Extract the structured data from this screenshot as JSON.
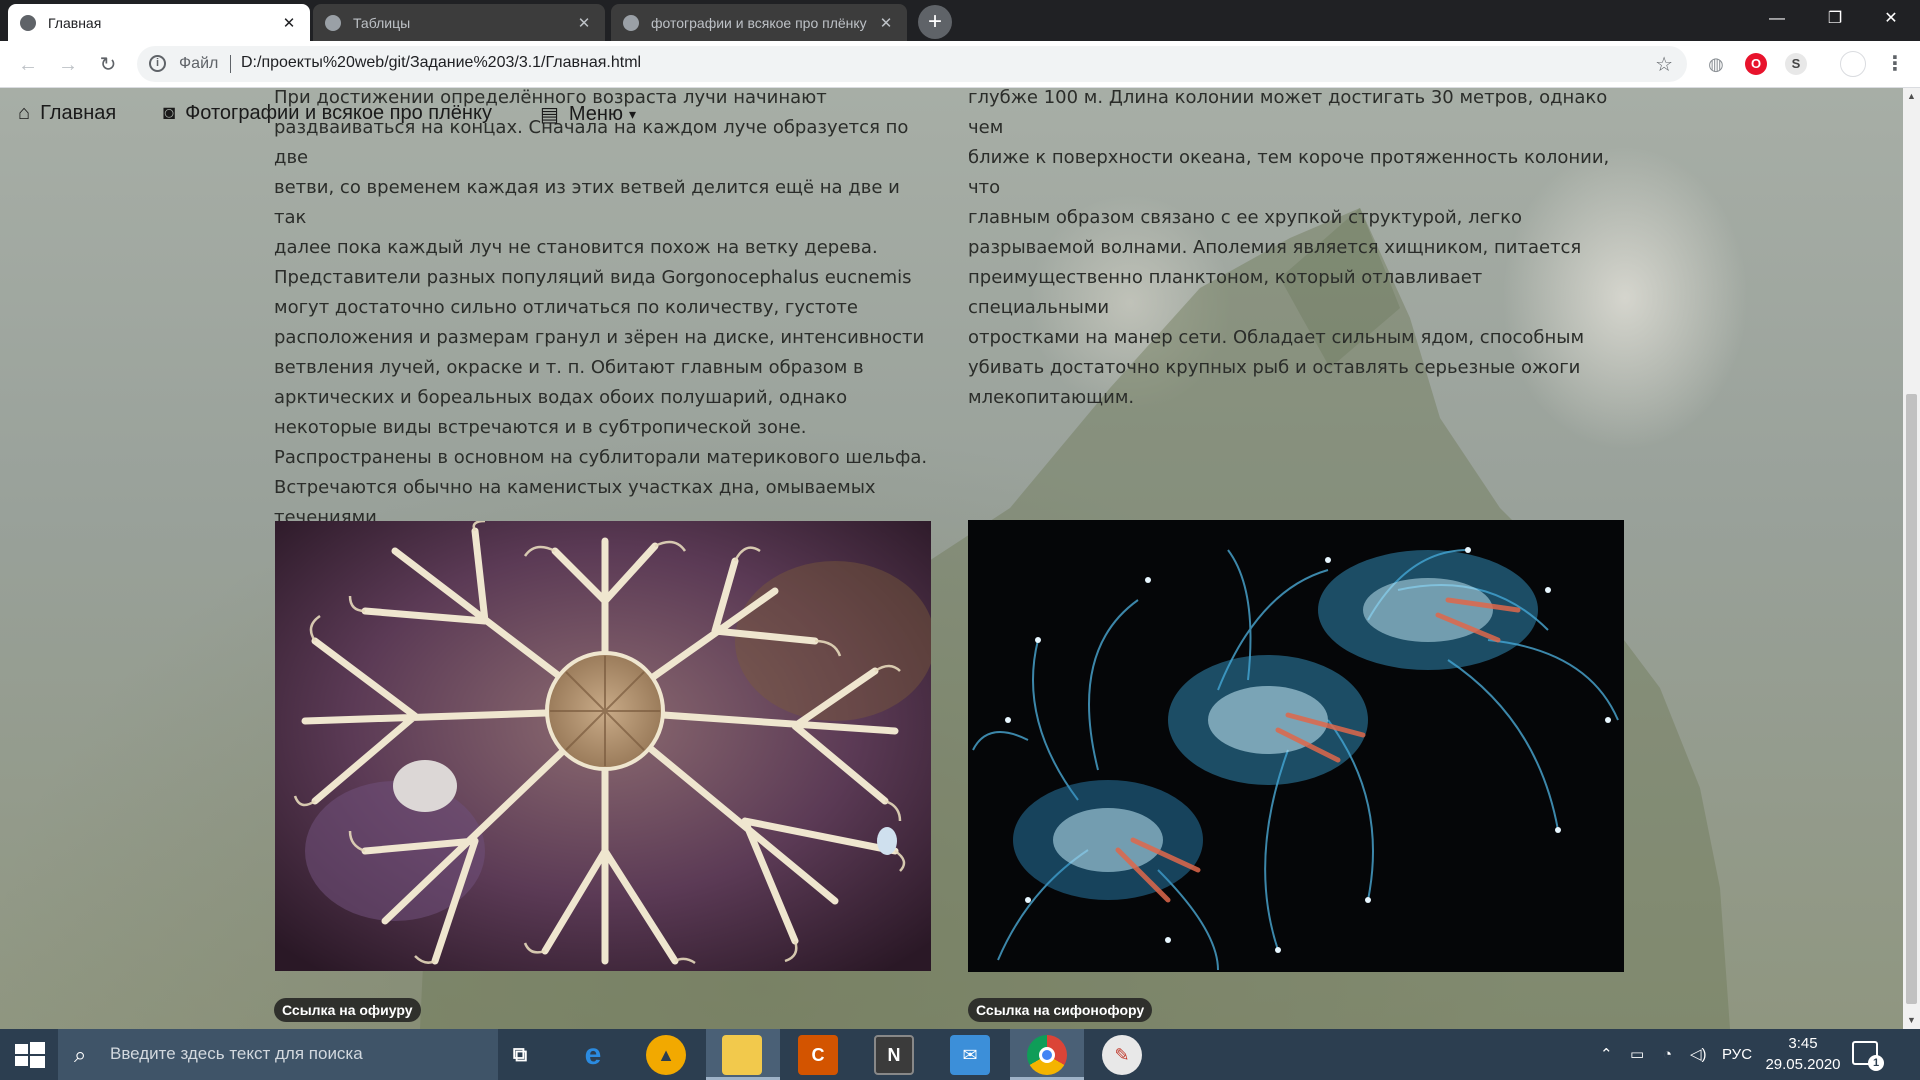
{
  "browser": {
    "tabs": [
      {
        "title": "Главная",
        "close": "✕"
      },
      {
        "title": "Таблицы",
        "close": "✕"
      },
      {
        "title": "фотографии и всякое про плёнку",
        "close": "✕"
      }
    ],
    "new_tab_label": "+",
    "window_controls": {
      "minimize": "—",
      "restore": "❐",
      "close": "✕"
    },
    "nav": {
      "back": "←",
      "forward": "→",
      "reload": "↻"
    },
    "omnibox": {
      "info_glyph": "i",
      "scheme_label": "Файл",
      "url": "D:/проекты%20web/git/Задание%203/3.1/Главная.html",
      "star": "☆"
    },
    "extensions": [
      {
        "name": "globe",
        "glyph": "◍"
      },
      {
        "name": "opera",
        "glyph": "O"
      },
      {
        "name": "s",
        "glyph": "S"
      },
      {
        "name": "avatar",
        "glyph": ""
      },
      {
        "name": "menu",
        "glyph": "⋮"
      }
    ]
  },
  "page": {
    "navbar": [
      {
        "label": "Главная",
        "icon": "home-icon",
        "glyph": "⌂"
      },
      {
        "label": "Фотографии и всякое про плёнку",
        "icon": "camera-icon",
        "glyph": "◙"
      },
      {
        "label": "Меню",
        "icon": "list-icon",
        "glyph": "▤",
        "caret": "▾"
      }
    ],
    "left_text": "При достижении определённого возраста лучи начинают\nраздваиваться на концах. Сначала на каждом луче образуется по две\nветви, со временем каждая из этих ветвей делится ещё на две и так\nдалее пока каждый луч не становится похож на ветку дерева.\nПредставители разных популяций вида Gorgonocephalus eucnemis\nмогут достаточно сильно отличаться по количеству, густоте\nрасположения и размерам гранул и зёрен на диске, интенсивности\nветвления лучей, окраске и т. п. Обитают главным образом в\nарктических и бореальных водах обоих полушарий, однако\nнекоторые виды встречаются и в субтропической зоне.\nРаспространены в основном на сублиторали материкового шельфа.\nВстречаются обычно на каменистых участках дна, омываемых\nтечениями",
    "right_text": "глубже 100 м. Длина колонии может достигать 30 метров, однако чем\nближе к поверхности океана, тем короче протяженность колонии, что\nглавным образом связано с ее хрупкой структурой, легко\nразрываемой волнами. Аполемия является хищником, питается\nпреимущественно планктоном, который отлавливает специальными\nотростками на манер сети. Обладает сильным ядом, способным\nубивать достаточно крупных рыб и оставлять серьезные ожоги\nмлекопитающим.",
    "cards": [
      {
        "image": "basket-star-photo",
        "link_label": "Ссылка на офиуру"
      },
      {
        "image": "siphonophore-photo",
        "link_label": "Ссылка на сифонофору"
      }
    ],
    "colors": {
      "text": "#2b2d2a",
      "badge": "#2f302c",
      "background": "#9aa29b"
    }
  },
  "taskbar": {
    "search_placeholder": "Введите здесь текст для поиска",
    "apps": [
      "task-view",
      "edge",
      "avast",
      "file-explorer",
      "ccleaner",
      "notion",
      "mail",
      "chrome",
      "paint"
    ],
    "tray": {
      "chevron": "⌃",
      "battery": "▭",
      "network": "◔",
      "volume": "◁)",
      "language": "РУС"
    },
    "clock": {
      "time": "3:45",
      "date": "29.05.2020"
    },
    "notifications": {
      "count": "1"
    }
  }
}
